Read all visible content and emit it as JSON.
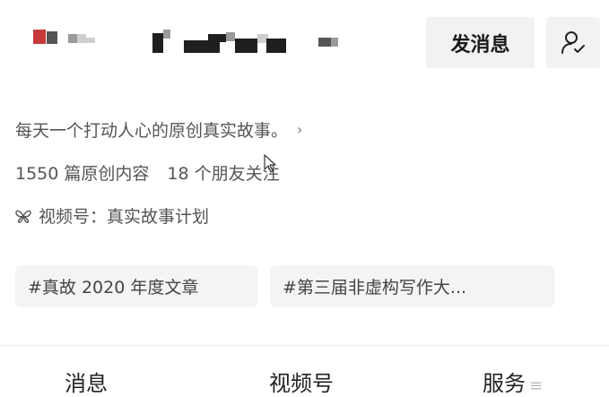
{
  "header": {
    "send_message_label": "发消息",
    "follow_icon": "user-follow-icon"
  },
  "profile": {
    "bio": "每天一个打动人心的原创真实故事。",
    "bio_arrow": "›",
    "stats": {
      "original_count_text": "1550 篇原创内容",
      "friends_follow_text": "18 个朋友关注"
    },
    "channel_text": "视频号：真实故事计划",
    "channel_icon": "butterfly-icon"
  },
  "tags": [
    "#真故 2020 年度文章",
    "#第三届非虚构写作大..."
  ],
  "tabs": [
    {
      "label": "消息"
    },
    {
      "label": "视频号"
    },
    {
      "label": "服务",
      "icon": "≡"
    }
  ]
}
